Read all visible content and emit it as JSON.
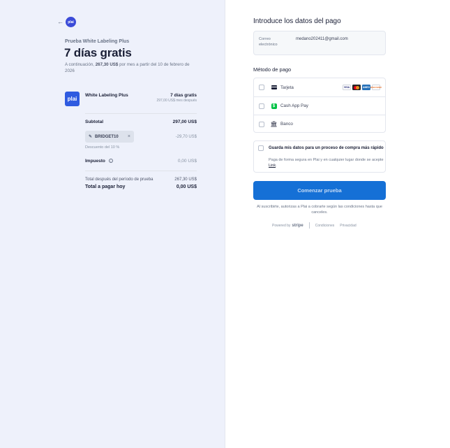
{
  "header": {
    "back_symbol": "←",
    "logo_text": "plai"
  },
  "summary": {
    "product_name": "Prueba White Labeling Plus",
    "title": "7 días gratis",
    "subtitle_prefix": "A continuación, ",
    "subtitle_amount": "267,30 US$",
    "subtitle_suffix": " por mes a partir del 10 de febrero de 2026",
    "item": {
      "logo_text": "plai",
      "name": "White Labeling Plus",
      "price": "7 días gratis",
      "after": "297,00 US$ mes después"
    },
    "subtotal_label": "Subtotal",
    "subtotal_value": "297,00 US$",
    "promo_code": "BRIDGET10",
    "promo_amount": "-29,70 US$",
    "promo_desc": "Descuento del 10 %",
    "tax_label": "Impuesto",
    "tax_value": "0,00 US$",
    "total_after_label": "Total después del período de prueba",
    "total_after_value": "267,30 US$",
    "total_today_label": "Total a pagar hoy",
    "total_today_value": "0,00 US$"
  },
  "payment": {
    "section_title": "Introduce los datos del pago",
    "email_label": "Correo electrónico",
    "email_value": "medano202411@gmail.com",
    "method_title": "Método de pago",
    "methods": [
      {
        "label": "Tarjeta",
        "icon": "card-icon"
      },
      {
        "label": "Cash App Pay",
        "icon": "cashapp-icon"
      },
      {
        "label": "Banco",
        "icon": "bank-icon"
      }
    ],
    "brands": [
      "VISA",
      "",
      "AMEX",
      "DISCOVER"
    ],
    "save_title": "Guarda mis datos para un proceso de compra más rápido",
    "save_desc": "Paga de forma segura en Plai y en cualquier lugar donde se acepte ",
    "save_link": "Link",
    "save_desc_end": ".",
    "cta_label": "Comenzar prueba",
    "legal": "Al suscribirte, autorizas a Plai a cobrarte según las condiciones hasta que canceles."
  },
  "footer": {
    "powered_by": "Powered by",
    "stripe": "stripe",
    "terms": "Condiciones",
    "privacy": "Privacidad"
  },
  "colors": {
    "left_bg": "#eef1fb",
    "accent": "#1570d6",
    "brand": "#2f5be0"
  }
}
